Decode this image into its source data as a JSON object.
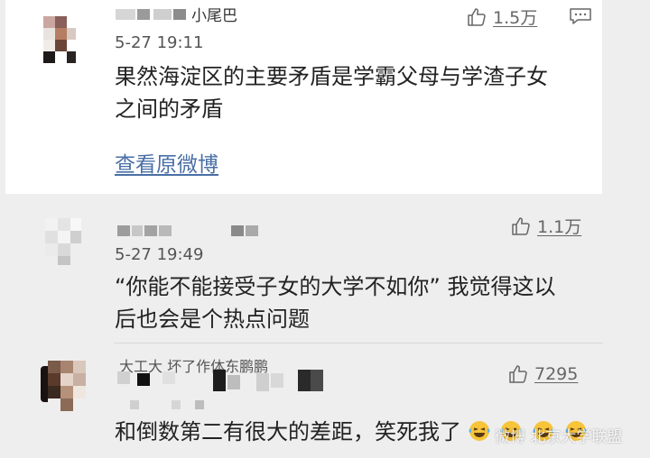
{
  "comments": [
    {
      "username_visible_fragment": "小尾巴",
      "time": "5-27 19:11",
      "content_line1": "果然海淀区的主要矛盾是学霸父母与学渣子女",
      "content_line2": "之间的矛盾",
      "link_label": "查看原微博",
      "likes": "1.5万"
    },
    {
      "time": "5-27 19:49",
      "content_line1": "“你能不能接受子女的大学不如你” 我觉得这以",
      "content_line2": "后也会是个热点问题",
      "likes": "1.1万"
    },
    {
      "username_visible_fragment": "大工大  坏了作体东鹏鹏",
      "content_line1": "和倒数第二有很大的差距，笑死我了",
      "likes": "7295",
      "emoji_count": 4
    }
  ],
  "watermark": "微博 北京大学联盟",
  "icons": [
    "thumbs-up-icon",
    "comment-icon",
    "laughing-emoji-icon"
  ],
  "colors": {
    "link": "#4a6fa5",
    "background": "#eeeeee",
    "card": "#ffffff"
  }
}
